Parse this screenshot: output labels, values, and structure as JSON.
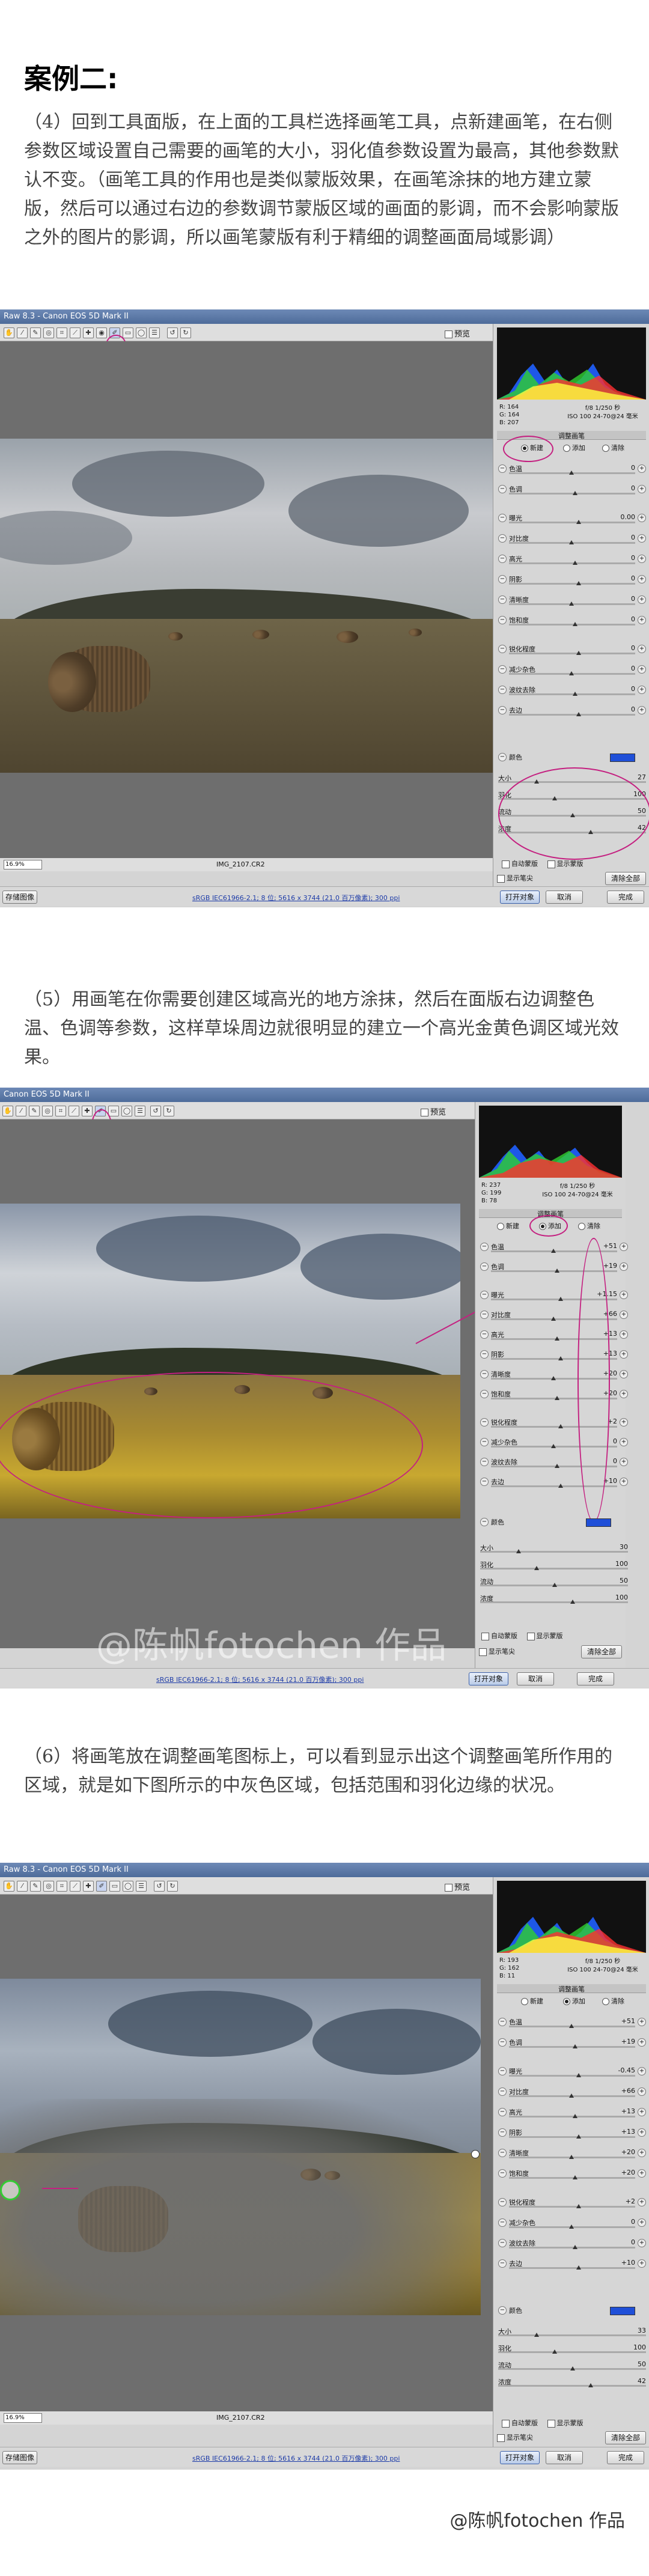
{
  "title": "案例二:",
  "step4": {
    "text": "（4）回到工具面版，在上面的工具栏选择画笔工具，点新建画笔，在右侧参数区域设置自己需要的画笔的大小，羽化值参数设置为最高，其他参数默认不变。（画笔工具的作用也是类似蒙版效果，在画笔涂抹的地方建立蒙版，然后可以通过右边的参数调节蒙版区域的画面的影调，而不会影响蒙版之外的图片的影调，所以画笔蒙版有利于精细的调整画面局域影调）"
  },
  "step5": {
    "text": "（5）用画笔在你需要创建区域高光的地方涂抹，然后在面版右边调整色温、色调等参数，这样草垛周边就很明显的建立一个高光金黄色调区域光效果。"
  },
  "step6": {
    "text": "（6）将画笔放在调整画笔图标上，可以看到显示出这个调整画笔所作用的区域，就是如下图所示的中灰色区域，包括范围和羽化边缘的状况。"
  },
  "screenshot1": {
    "titlebar": "Raw 8.3 - Canon EOS 5D Mark II",
    "preview_label": "预览",
    "zoom": "16.9%",
    "filename": "IMG_2107.CR2",
    "info_link": "sRGB IEC61966-2.1; 8 位; 5616 x 3744 (21.0 百万像素); 300 ppi",
    "rgb": [
      "R:  164",
      "G:  164",
      "B:  207"
    ],
    "camera": [
      "f/8   1/250 秒",
      "ISO 100   24-70@24 毫米"
    ],
    "panel_title": "调整画笔",
    "modes": [
      "新建",
      "添加",
      "清除"
    ],
    "sliders": [
      {
        "label": "色温",
        "value": "0"
      },
      {
        "label": "色调",
        "value": "0"
      },
      {
        "label": "曝光",
        "value": "0.00"
      },
      {
        "label": "对比度",
        "value": "0"
      },
      {
        "label": "高光",
        "value": "0"
      },
      {
        "label": "阴影",
        "value": "0"
      },
      {
        "label": "清晰度",
        "value": "0"
      },
      {
        "label": "饱和度",
        "value": "0"
      },
      {
        "label": "锐化程度",
        "value": "0"
      },
      {
        "label": "减少杂色",
        "value": "0"
      },
      {
        "label": "波纹去除",
        "value": "0"
      },
      {
        "label": "去边",
        "value": "0"
      }
    ],
    "color_label": "颜色",
    "brush": [
      {
        "label": "大小",
        "value": "27"
      },
      {
        "label": "羽化",
        "value": "100"
      },
      {
        "label": "流动",
        "value": "50"
      },
      {
        "label": "浓度",
        "value": "42"
      }
    ],
    "auto_mask": "自动蒙版",
    "show_mask": "显示蒙版",
    "show_pins": "显示笔尖",
    "clear_all": "清除全部",
    "left_btn": "存储图像",
    "open": "打开对象",
    "cancel": "取消",
    "done": "完成"
  },
  "screenshot2": {
    "titlebar": "Canon EOS 5D Mark II",
    "preview_label": "预览",
    "info_link": "sRGB IEC61966-2.1; 8 位; 5616 x 3744 (21.0 百万像素); 300 ppi",
    "rgb": [
      "R:  237",
      "G:  199",
      "B:   78"
    ],
    "camera": [
      "f/8   1/250 秒",
      "ISO 100   24-70@24 毫米"
    ],
    "panel_title": "调整画笔",
    "modes": [
      "新建",
      "添加",
      "清除"
    ],
    "sliders": [
      {
        "label": "色温",
        "value": "+51"
      },
      {
        "label": "色调",
        "value": "+19"
      },
      {
        "label": "曝光",
        "value": "+1.15"
      },
      {
        "label": "对比度",
        "value": "+66"
      },
      {
        "label": "高光",
        "value": "+13"
      },
      {
        "label": "阴影",
        "value": "+13"
      },
      {
        "label": "清晰度",
        "value": "+20"
      },
      {
        "label": "饱和度",
        "value": "+20"
      },
      {
        "label": "锐化程度",
        "value": "+2"
      },
      {
        "label": "减少杂色",
        "value": "0"
      },
      {
        "label": "波纹去除",
        "value": "0"
      },
      {
        "label": "去边",
        "value": "+10"
      }
    ],
    "color_label": "颜色",
    "brush": [
      {
        "label": "大小",
        "value": "30"
      },
      {
        "label": "羽化",
        "value": "100"
      },
      {
        "label": "流动",
        "value": "50"
      },
      {
        "label": "浓度",
        "value": "100"
      }
    ],
    "auto_mask": "自动蒙版",
    "show_mask": "显示蒙版",
    "show_pins": "显示笔尖",
    "clear_all": "清除全部",
    "open": "打开对象",
    "cancel": "取消",
    "done": "完成",
    "watermark": "@陈帆fotochen 作品"
  },
  "screenshot3": {
    "titlebar": "Raw 8.3 - Canon EOS 5D Mark II",
    "preview_label": "预览",
    "zoom": "16.9%",
    "filename": "IMG_2107.CR2",
    "info_link": "sRGB IEC61966-2.1; 8 位; 5616 x 3744 (21.0 百万像素); 300 ppi",
    "rgb": [
      "R:  193",
      "G:  162",
      "B:   11"
    ],
    "camera": [
      "f/8   1/250 秒",
      "ISO 100   24-70@24 毫米"
    ],
    "panel_title": "调整画笔",
    "modes": [
      "新建",
      "添加",
      "清除"
    ],
    "sliders": [
      {
        "label": "色温",
        "value": "+51"
      },
      {
        "label": "色调",
        "value": "+19"
      },
      {
        "label": "曝光",
        "value": "-0.45"
      },
      {
        "label": "对比度",
        "value": "+66"
      },
      {
        "label": "高光",
        "value": "+13"
      },
      {
        "label": "阴影",
        "value": "+13"
      },
      {
        "label": "清晰度",
        "value": "+20"
      },
      {
        "label": "饱和度",
        "value": "+20"
      },
      {
        "label": "锐化程度",
        "value": "+2"
      },
      {
        "label": "减少杂色",
        "value": "0"
      },
      {
        "label": "波纹去除",
        "value": "0"
      },
      {
        "label": "去边",
        "value": "+10"
      }
    ],
    "color_label": "颜色",
    "brush": [
      {
        "label": "大小",
        "value": "33"
      },
      {
        "label": "羽化",
        "value": "100"
      },
      {
        "label": "流动",
        "value": "50"
      },
      {
        "label": "浓度",
        "value": "42"
      }
    ],
    "auto_mask": "自动蒙版",
    "show_mask": "显示蒙版",
    "show_pins": "显示笔尖",
    "clear_all": "清除全部",
    "left_btn": "存储图像",
    "open": "打开对象",
    "cancel": "取消",
    "done": "完成"
  },
  "signature": "@陈帆fotochen 作品"
}
